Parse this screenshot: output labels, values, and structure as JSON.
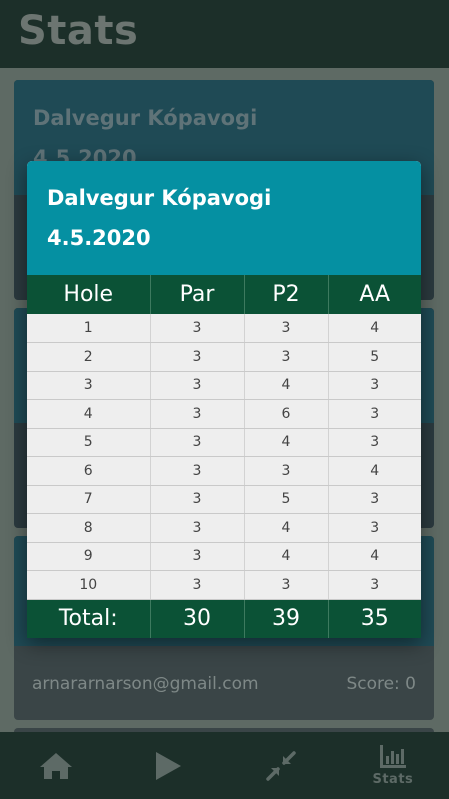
{
  "app": {
    "title": "Stats"
  },
  "background_card": {
    "course": "Dalvegur Kópavogi",
    "date": "4.5.2020",
    "email": "arnararnarson@gmail.com",
    "score": "Score: 0"
  },
  "modal": {
    "course": "Dalvegur Kópavogi",
    "date": "4.5.2020",
    "columns": [
      "Hole",
      "Par",
      "P2",
      "AA"
    ],
    "rows": [
      [
        "1",
        "3",
        "3",
        "4"
      ],
      [
        "2",
        "3",
        "3",
        "5"
      ],
      [
        "3",
        "3",
        "4",
        "3"
      ],
      [
        "4",
        "3",
        "6",
        "3"
      ],
      [
        "5",
        "3",
        "4",
        "3"
      ],
      [
        "6",
        "3",
        "3",
        "4"
      ],
      [
        "7",
        "3",
        "5",
        "3"
      ],
      [
        "8",
        "3",
        "4",
        "3"
      ],
      [
        "9",
        "3",
        "4",
        "4"
      ],
      [
        "10",
        "3",
        "3",
        "3"
      ]
    ],
    "totals": [
      "Total:",
      "30",
      "39",
      "35"
    ]
  },
  "nav": {
    "items": [
      {
        "icon": "home-icon"
      },
      {
        "icon": "play-icon"
      },
      {
        "icon": "collapse-icon"
      },
      {
        "icon": "bar-chart-icon",
        "label": "Stats"
      }
    ]
  },
  "colors": {
    "header": "#1c2f29",
    "modal_header": "#0590a2",
    "table_header": "#0b5236",
    "row_bg": "#eeeeee"
  }
}
